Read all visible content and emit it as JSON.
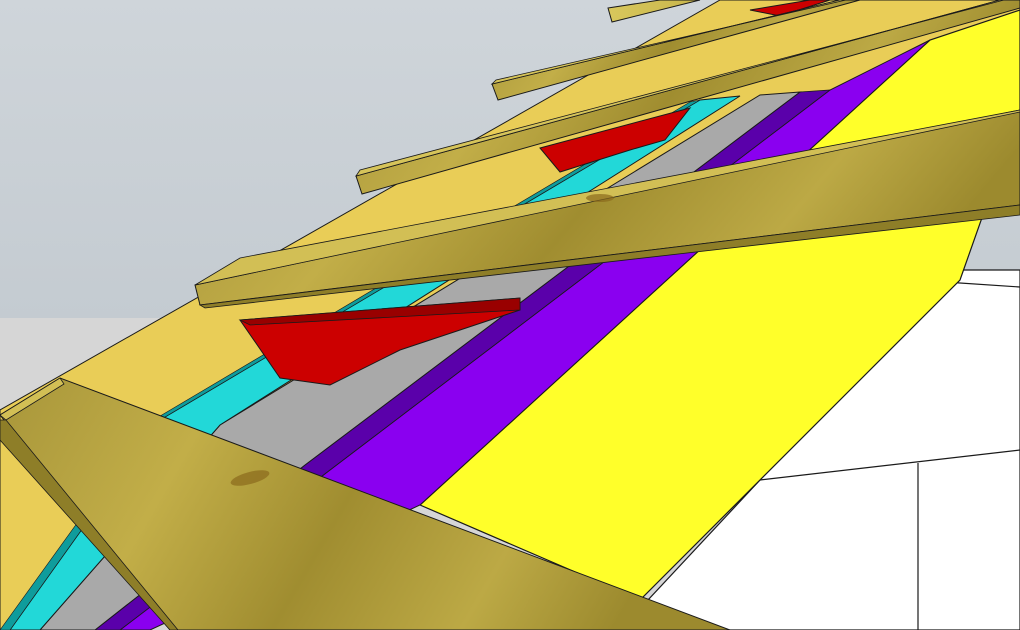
{
  "scene": {
    "view": "3d-model-viewport",
    "subject": "roof-layer-build-up",
    "colors": {
      "sky": "#cdd3d8",
      "ground": "#d9d9d9",
      "wall": "#ffffff",
      "outline": "#1a1a1a",
      "wood": "#b3a13d",
      "wood_light": "#d9c659",
      "wood_dark": "#8a7a26",
      "sheathing": "#e8cc55",
      "insulation_red": "#cc0000",
      "insulation_red_dark": "#990000",
      "vapour_cyan": "#22d5d5",
      "vapour_cyan_dark": "#0e9a9a",
      "membrane_gray": "#a8a8a8",
      "membrane_purple": "#8800ee",
      "membrane_purple_dark": "#5a00a8",
      "membrane_yellow": "#ffff2a"
    },
    "layers": [
      {
        "id": "yellow-membrane",
        "color_key": "membrane_yellow"
      },
      {
        "id": "purple-membrane",
        "color_key": "membrane_purple"
      },
      {
        "id": "gray-membrane",
        "color_key": "membrane_gray"
      },
      {
        "id": "cyan-strip",
        "color_key": "vapour_cyan"
      },
      {
        "id": "red-insulation",
        "color_key": "insulation_red"
      },
      {
        "id": "sheathing-board",
        "color_key": "sheathing"
      }
    ],
    "battens": [
      {
        "id": "batten-1"
      },
      {
        "id": "batten-2"
      },
      {
        "id": "batten-3"
      },
      {
        "id": "batten-4"
      },
      {
        "id": "batten-5"
      }
    ]
  }
}
